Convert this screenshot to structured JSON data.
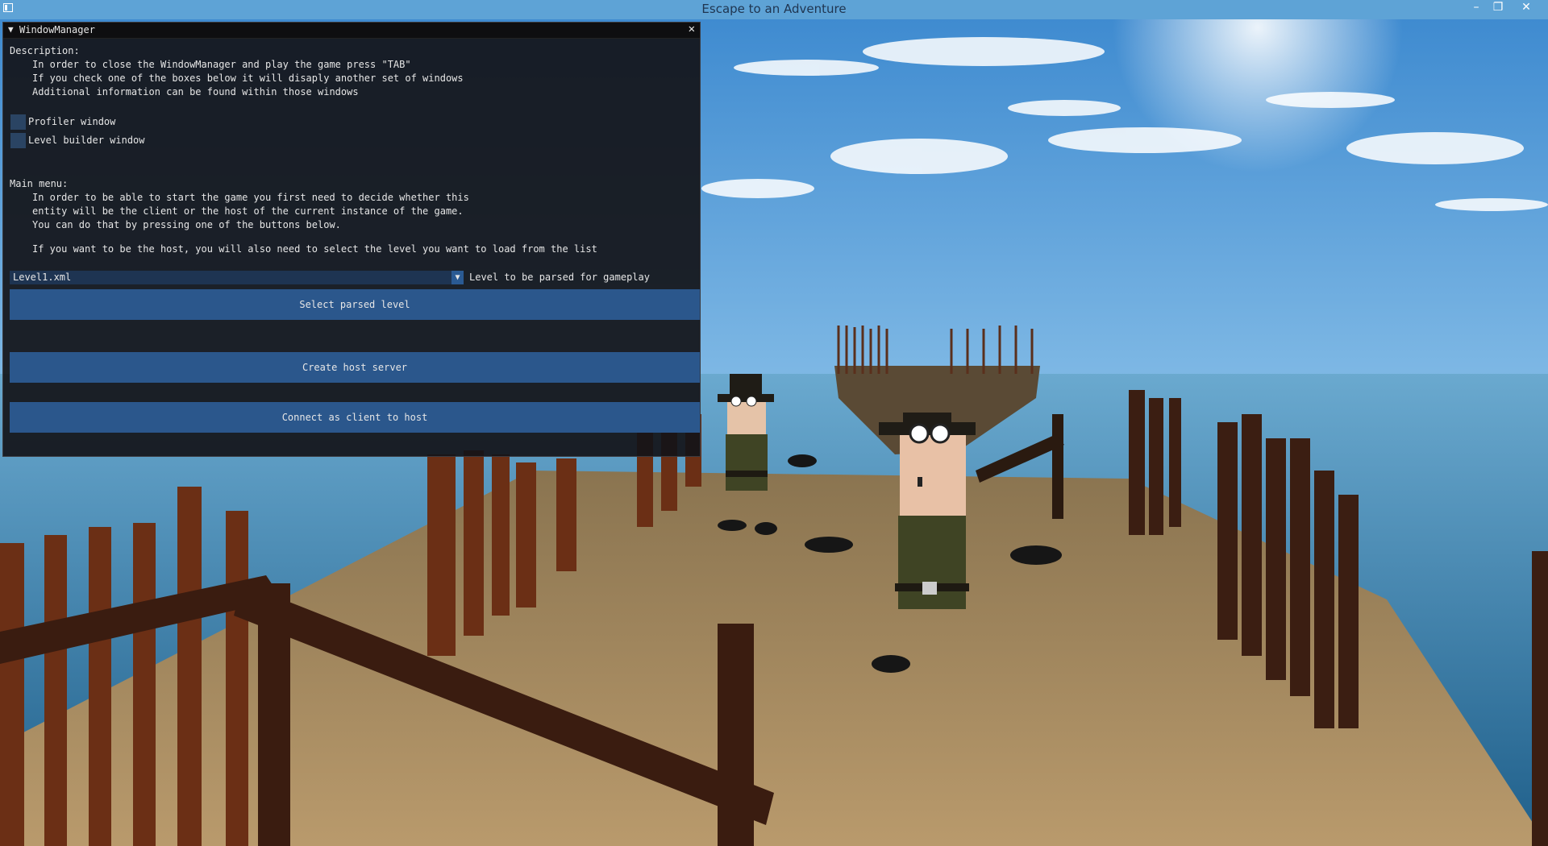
{
  "window": {
    "title": "Escape to an Adventure",
    "controls": {
      "minimize": "–",
      "maximize": "❐",
      "close": "✕"
    }
  },
  "window_manager": {
    "title": "WindowManager",
    "collapse_icon": "▼",
    "close_icon": "✕",
    "description_heading": "Description:",
    "description_lines": [
      "In order to close the WindowManager and play the game press \"TAB\"",
      "If you check one of the boxes below it will disaply another set of windows",
      "Additional information can be found within those windows"
    ],
    "checkboxes": [
      {
        "label": "Profiler window",
        "checked": false
      },
      {
        "label": "Level builder window",
        "checked": false
      }
    ],
    "main_menu_heading": "Main menu:",
    "main_menu_lines": [
      "In order to be able to start the game you first need to decide whether this",
      "entity will be the client or the host of the current instance of the game.",
      "You can do that by pressing one of the buttons below.",
      "If you want to be the host, you will also need to select the level you want to load from the list"
    ],
    "level_select": {
      "value": "Level1.xml",
      "arrow": "▼",
      "label": "Level to be parsed for gameplay"
    },
    "buttons": {
      "select_level": "Select parsed level",
      "create_host": "Create host server",
      "connect_client": "Connect as client to host"
    }
  },
  "colors": {
    "titlebar": "#5ea3d6",
    "panel_bg": "#141418",
    "button": "#2b578c",
    "checkbox": "#2a4463"
  }
}
